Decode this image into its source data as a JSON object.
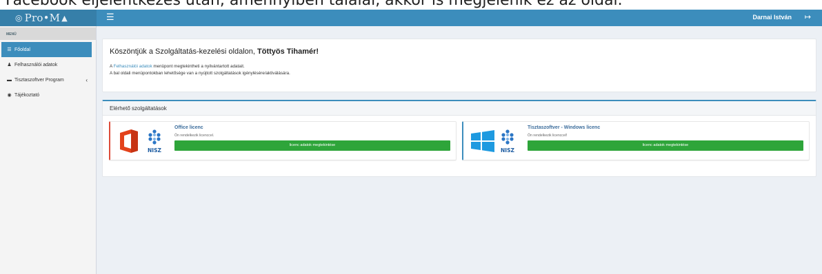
{
  "caption": {
    "text": "Facebook éljelentkezés után, amennyiben találál, akkor is megjelenik ez az oldal."
  },
  "header": {
    "logo_text": "Pro•M",
    "user_name": "Darnai István",
    "accent": "#3c8dbc",
    "logo_bg": "#367fa9"
  },
  "sidebar": {
    "menu_heading": "MENÜ",
    "items": [
      {
        "label": "Főoldal",
        "icon": "list-icon"
      },
      {
        "label": "Felhasználói adatok",
        "icon": "user-icon"
      },
      {
        "label": "Tisztaszoftver Program",
        "icon": "laptop-icon"
      },
      {
        "label": "Tájékoztató",
        "icon": "info-icon"
      }
    ]
  },
  "welcome": {
    "title_prefix": "Köszöntjük a Szolgáltatás-kezelési oldalon, ",
    "title_name": "Töttyös Tihamér!",
    "line1_prefix": "A ",
    "line1_link": "Felhasználói adatok",
    "line1_suffix": " menüpont megtekintheti a nyilvántartott adatait.",
    "line2": "A bal oldali menüpontokban lehetősége van a nyújtott szolgáltatások igénylésére/aktiválására."
  },
  "services": {
    "heading": "Elérhető szolgáltatások",
    "cards": [
      {
        "title": "Office licenc",
        "subtitle": "Ön rendelkezik licenccel.",
        "button": "licenc adatok megtekintése",
        "icon": "office-icon",
        "brand": "NISZ",
        "border_color": "#dd4b39"
      },
      {
        "title": "Tisztaszoftver - Windows licenc",
        "subtitle": "Ön rendelkezik licenccel!",
        "button": "licenc adatok megtekintése",
        "icon": "windows-icon",
        "brand": "NISZ",
        "border_color": "#3c8dbc"
      }
    ]
  }
}
